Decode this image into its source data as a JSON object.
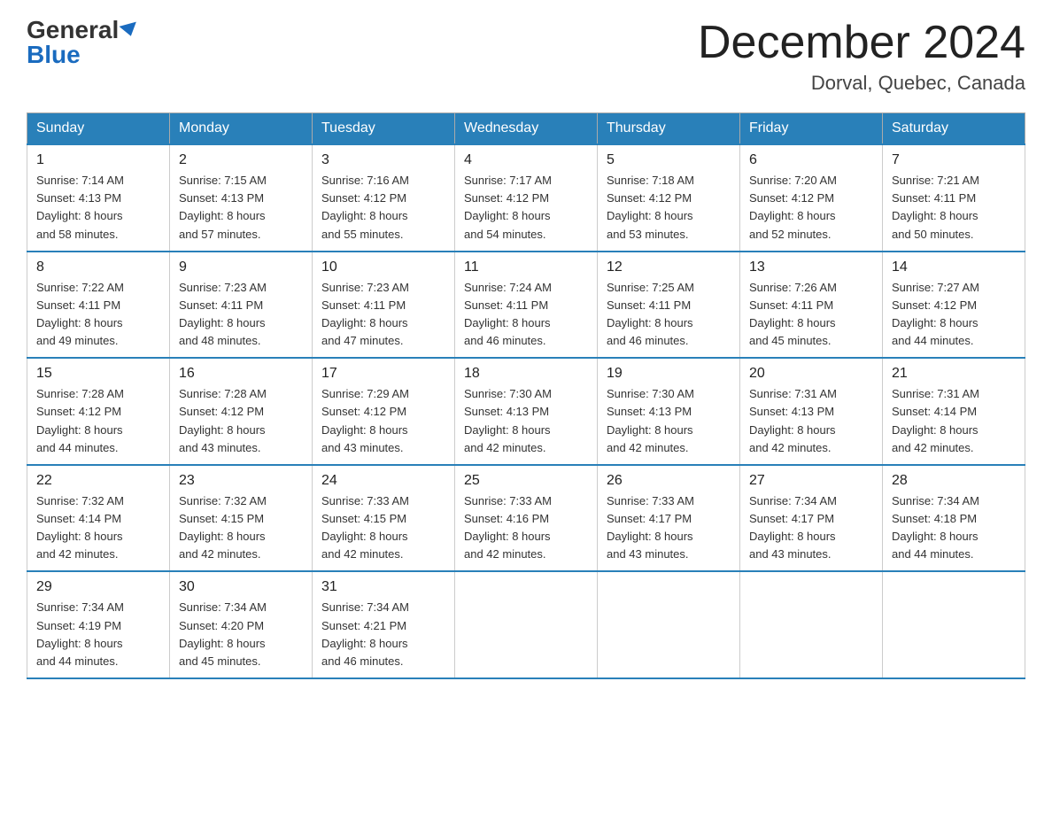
{
  "header": {
    "logo_general": "General",
    "logo_blue": "Blue",
    "month_title": "December 2024",
    "location": "Dorval, Quebec, Canada"
  },
  "days_of_week": [
    "Sunday",
    "Monday",
    "Tuesday",
    "Wednesday",
    "Thursday",
    "Friday",
    "Saturday"
  ],
  "weeks": [
    [
      {
        "day": "1",
        "sunrise": "7:14 AM",
        "sunset": "4:13 PM",
        "daylight": "8 hours and 58 minutes."
      },
      {
        "day": "2",
        "sunrise": "7:15 AM",
        "sunset": "4:13 PM",
        "daylight": "8 hours and 57 minutes."
      },
      {
        "day": "3",
        "sunrise": "7:16 AM",
        "sunset": "4:12 PM",
        "daylight": "8 hours and 55 minutes."
      },
      {
        "day": "4",
        "sunrise": "7:17 AM",
        "sunset": "4:12 PM",
        "daylight": "8 hours and 54 minutes."
      },
      {
        "day": "5",
        "sunrise": "7:18 AM",
        "sunset": "4:12 PM",
        "daylight": "8 hours and 53 minutes."
      },
      {
        "day": "6",
        "sunrise": "7:20 AM",
        "sunset": "4:12 PM",
        "daylight": "8 hours and 52 minutes."
      },
      {
        "day": "7",
        "sunrise": "7:21 AM",
        "sunset": "4:11 PM",
        "daylight": "8 hours and 50 minutes."
      }
    ],
    [
      {
        "day": "8",
        "sunrise": "7:22 AM",
        "sunset": "4:11 PM",
        "daylight": "8 hours and 49 minutes."
      },
      {
        "day": "9",
        "sunrise": "7:23 AM",
        "sunset": "4:11 PM",
        "daylight": "8 hours and 48 minutes."
      },
      {
        "day": "10",
        "sunrise": "7:23 AM",
        "sunset": "4:11 PM",
        "daylight": "8 hours and 47 minutes."
      },
      {
        "day": "11",
        "sunrise": "7:24 AM",
        "sunset": "4:11 PM",
        "daylight": "8 hours and 46 minutes."
      },
      {
        "day": "12",
        "sunrise": "7:25 AM",
        "sunset": "4:11 PM",
        "daylight": "8 hours and 46 minutes."
      },
      {
        "day": "13",
        "sunrise": "7:26 AM",
        "sunset": "4:11 PM",
        "daylight": "8 hours and 45 minutes."
      },
      {
        "day": "14",
        "sunrise": "7:27 AM",
        "sunset": "4:12 PM",
        "daylight": "8 hours and 44 minutes."
      }
    ],
    [
      {
        "day": "15",
        "sunrise": "7:28 AM",
        "sunset": "4:12 PM",
        "daylight": "8 hours and 44 minutes."
      },
      {
        "day": "16",
        "sunrise": "7:28 AM",
        "sunset": "4:12 PM",
        "daylight": "8 hours and 43 minutes."
      },
      {
        "day": "17",
        "sunrise": "7:29 AM",
        "sunset": "4:12 PM",
        "daylight": "8 hours and 43 minutes."
      },
      {
        "day": "18",
        "sunrise": "7:30 AM",
        "sunset": "4:13 PM",
        "daylight": "8 hours and 42 minutes."
      },
      {
        "day": "19",
        "sunrise": "7:30 AM",
        "sunset": "4:13 PM",
        "daylight": "8 hours and 42 minutes."
      },
      {
        "day": "20",
        "sunrise": "7:31 AM",
        "sunset": "4:13 PM",
        "daylight": "8 hours and 42 minutes."
      },
      {
        "day": "21",
        "sunrise": "7:31 AM",
        "sunset": "4:14 PM",
        "daylight": "8 hours and 42 minutes."
      }
    ],
    [
      {
        "day": "22",
        "sunrise": "7:32 AM",
        "sunset": "4:14 PM",
        "daylight": "8 hours and 42 minutes."
      },
      {
        "day": "23",
        "sunrise": "7:32 AM",
        "sunset": "4:15 PM",
        "daylight": "8 hours and 42 minutes."
      },
      {
        "day": "24",
        "sunrise": "7:33 AM",
        "sunset": "4:15 PM",
        "daylight": "8 hours and 42 minutes."
      },
      {
        "day": "25",
        "sunrise": "7:33 AM",
        "sunset": "4:16 PM",
        "daylight": "8 hours and 42 minutes."
      },
      {
        "day": "26",
        "sunrise": "7:33 AM",
        "sunset": "4:17 PM",
        "daylight": "8 hours and 43 minutes."
      },
      {
        "day": "27",
        "sunrise": "7:34 AM",
        "sunset": "4:17 PM",
        "daylight": "8 hours and 43 minutes."
      },
      {
        "day": "28",
        "sunrise": "7:34 AM",
        "sunset": "4:18 PM",
        "daylight": "8 hours and 44 minutes."
      }
    ],
    [
      {
        "day": "29",
        "sunrise": "7:34 AM",
        "sunset": "4:19 PM",
        "daylight": "8 hours and 44 minutes."
      },
      {
        "day": "30",
        "sunrise": "7:34 AM",
        "sunset": "4:20 PM",
        "daylight": "8 hours and 45 minutes."
      },
      {
        "day": "31",
        "sunrise": "7:34 AM",
        "sunset": "4:21 PM",
        "daylight": "8 hours and 46 minutes."
      },
      null,
      null,
      null,
      null
    ]
  ],
  "labels": {
    "sunrise": "Sunrise:",
    "sunset": "Sunset:",
    "daylight": "Daylight:"
  }
}
